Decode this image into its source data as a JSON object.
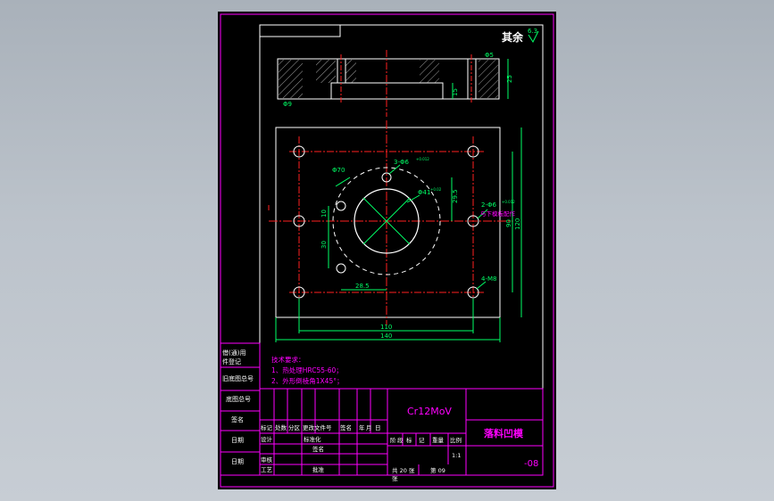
{
  "colors": {
    "background": "#000000",
    "frame": "#ff00ff",
    "outline": "#ffffff",
    "center": "#ff2020",
    "dimension": "#00ff66",
    "text_cad": "#ff00ff",
    "hatch": "#cccccc"
  },
  "surface_note": {
    "label": "其余",
    "roughness": "6.3"
  },
  "section_view": {
    "dims": {
      "d1": "Φ5",
      "d2": "25",
      "d3": "15",
      "d4": "Φ9"
    }
  },
  "plan_view": {
    "dims": {
      "holes_top": "3-Φ6",
      "holes_top_tol": "+0.012\n0",
      "circle_outer": "Φ70",
      "circle_inner": "Φ41",
      "circle_inner_tol": "+0.02",
      "v_29_5": "29.5",
      "v_10": "10",
      "v_30": "30",
      "h_28_5": "28.5",
      "pins": "2-Φ6",
      "pins_tol": "+0.012\n0",
      "pins_note": "与下模板配作",
      "screws": "4-M8",
      "v_90": "90",
      "v_120": "120",
      "h_110": "110",
      "h_140": "140"
    }
  },
  "tech_req": {
    "title": "技术要求：",
    "items": [
      "1、热处理HRC55-60；",
      "2、外形倒棱角1X45°；"
    ]
  },
  "left_column": {
    "labels": [
      "借(通)用",
      "件登记",
      "旧底图总号",
      "底图总号",
      "签名",
      "日期",
      "日期"
    ]
  },
  "title_block": {
    "material": "Cr12MoV",
    "part_name": "落料凹模",
    "drawing_no": "-08",
    "revision_header": [
      "标记",
      "处数",
      "分区",
      "更改文件号",
      "签名",
      "年",
      "月",
      "日"
    ],
    "roles": [
      "设计",
      "审核",
      "工艺"
    ],
    "roles2": [
      "标准化",
      "",
      "批准"
    ],
    "std": "标准化",
    "pass": "签名",
    "stage_header": [
      "阶",
      "段",
      "标",
      "记",
      "重量",
      "比例"
    ],
    "scale": "1:1",
    "sheets": "共 20 张",
    "sheet_no": "第 09",
    "sheet_unit": "张"
  }
}
